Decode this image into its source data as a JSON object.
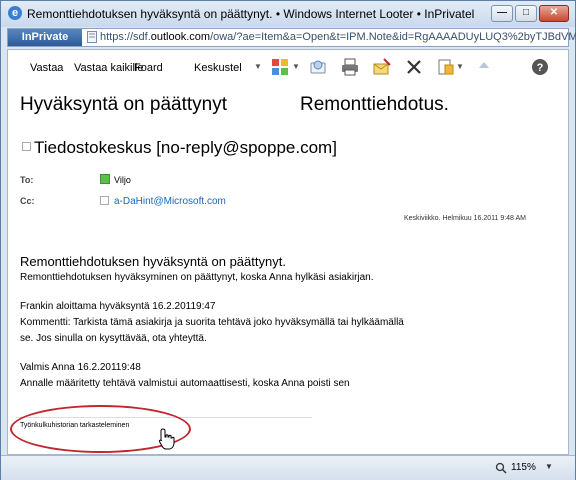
{
  "window": {
    "title": "Remonttiehdotuksen hyväksyntä on päättynyt. • Windows Internet Looter • InPrivatel",
    "min_glyph": "—",
    "max_glyph": "□",
    "close_glyph": "✕"
  },
  "address": {
    "inprivate_label": "InPrivate",
    "url_prefix": "https://sdf.",
    "url_domain": "outlook.com",
    "url_rest": "/owa/?ae=Item&a=Open&t=IPM.Note&id=RgAAAADUyLUQ3%2byTJBdVM"
  },
  "toolbar": {
    "reply": "Vastaa",
    "reply_all": "Vastaa kaikille",
    "forward": "Foard",
    "priority": "Keskustel"
  },
  "message": {
    "subject_left": "Hyväksyntä on päättynyt",
    "subject_right": "Remonttiehdotus.",
    "sender": "Tiedostokeskus [no-reply@spoppe.com]",
    "to_label": "To:",
    "to_name": "Viljo",
    "cc_label": "Cc:",
    "cc_name": "a-DaHint@Microsoft.com",
    "date": "Keskiviikko. Helmikuu 16.2011 9:48 AM"
  },
  "body": {
    "title": "Remonttiehdotuksen hyväksyntä on päättynyt.",
    "line1": "Remonttiehdotuksen hyväksyminen on päättynyt, koska Anna hylkäsi asiakirjan.",
    "line2": "Frankin aloittama hyväksyntä 16.2.20119:47",
    "line3": "Kommentti: Tarkista tämä asiakirja ja suorita tehtävä joko hyväksymällä tai hylkäämällä",
    "line4": "se. Jos sinulla on kysyttävää, ota yhteyttä.",
    "line5": "Valmis Anna 16.2.20119:48",
    "line6": "Annalle määritetty tehtävä valmistui automaattisesti, koska Anna poisti sen",
    "history_link": "Työnkulkuhistorian tarkasteleminen"
  },
  "status": {
    "zoom": "115%"
  },
  "colors": {
    "accent": "#2c5a99",
    "link": "#1a67b8",
    "annotation": "#c2262e"
  }
}
